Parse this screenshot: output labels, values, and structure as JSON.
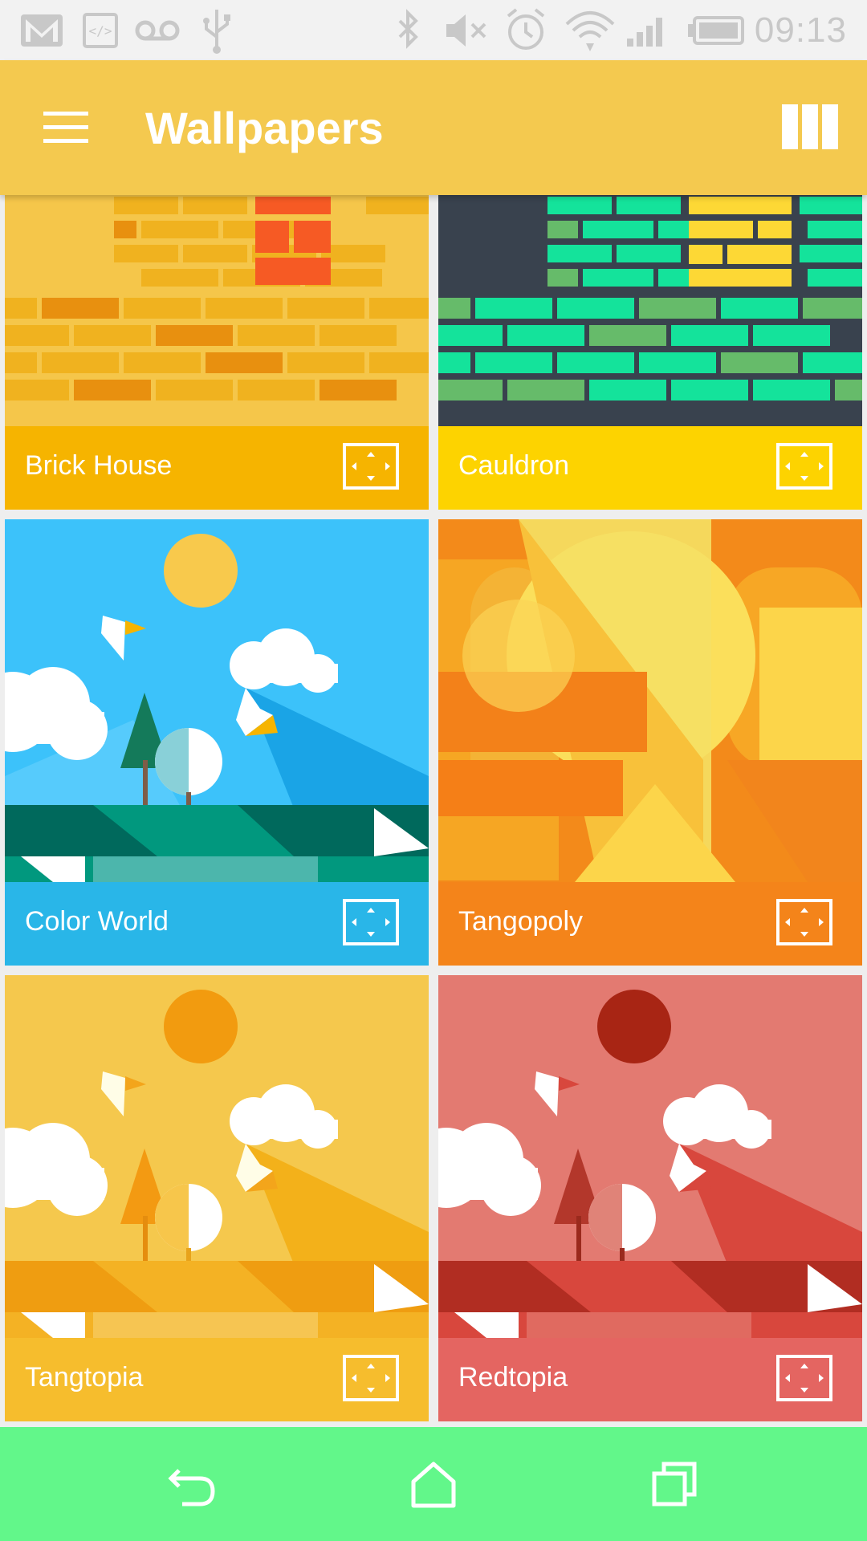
{
  "status_bar": {
    "time": "09:13",
    "left_icons": [
      "gmail-icon",
      "code-icon",
      "voicemail-icon",
      "usb-icon"
    ],
    "right_icons": [
      "bluetooth-icon",
      "mute-icon",
      "alarm-icon",
      "wifi-icon",
      "signal-icon",
      "battery-icon"
    ]
  },
  "app_bar": {
    "title": "Wallpapers",
    "menu_icon": "menu-icon",
    "layout_icon": "grid-view-icon",
    "color": "#f4c94f"
  },
  "wallpapers": [
    {
      "name": "Brick House",
      "caption_color": "#f6b400"
    },
    {
      "name": "Cauldron",
      "caption_color": "#fdd300"
    },
    {
      "name": "Color World",
      "caption_color": "#29b6e8"
    },
    {
      "name": "Tangopoly",
      "caption_color": "#f4841a"
    },
    {
      "name": "Tangtopia",
      "caption_color": "#f6bd2d"
    },
    {
      "name": "Redtopia",
      "caption_color": "#e46561"
    }
  ],
  "nav_bar": {
    "color": "#62f78a",
    "icons": [
      "back-icon",
      "home-icon",
      "recents-icon"
    ]
  }
}
